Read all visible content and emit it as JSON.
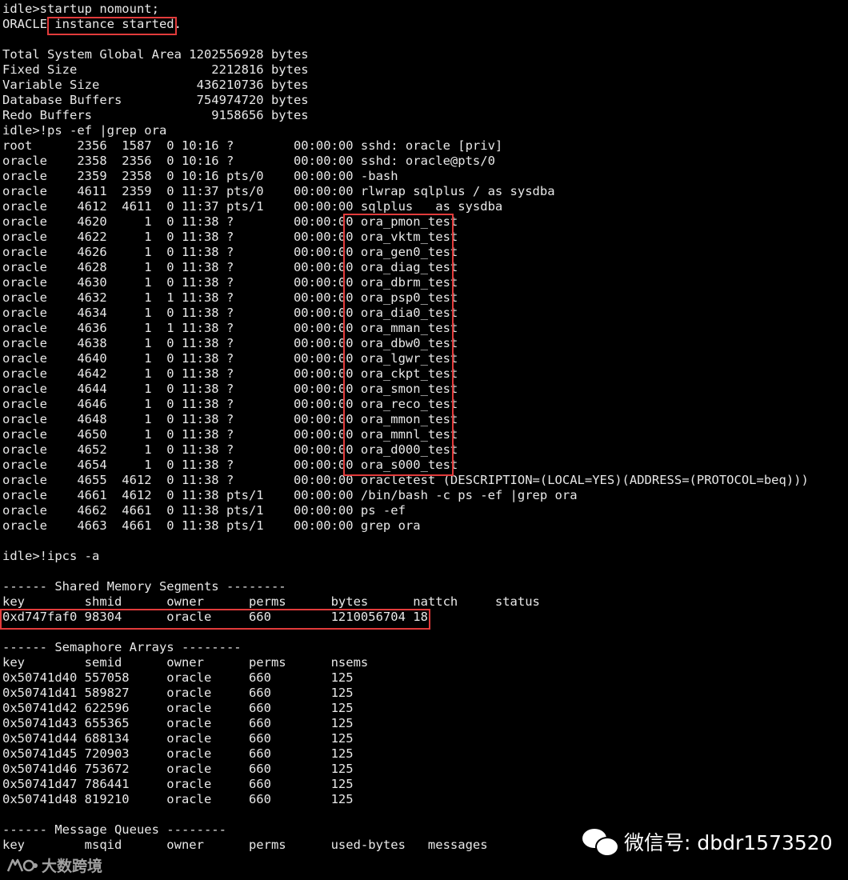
{
  "terminal": {
    "lines": [
      "idle>startup nomount;",
      "ORACLE instance started.",
      "",
      "Total System Global Area 1202556928 bytes",
      "Fixed Size                  2212816 bytes",
      "Variable Size             436210736 bytes",
      "Database Buffers          754974720 bytes",
      "Redo Buffers                9158656 bytes",
      "idle>!ps -ef |grep ora",
      "root      2356  1587  0 10:16 ?        00:00:00 sshd: oracle [priv]",
      "oracle    2358  2356  0 10:16 ?        00:00:00 sshd: oracle@pts/0",
      "oracle    2359  2358  0 10:16 pts/0    00:00:00 -bash",
      "oracle    4611  2359  0 11:37 pts/0    00:00:00 rlwrap sqlplus / as sysdba",
      "oracle    4612  4611  0 11:37 pts/1    00:00:00 sqlplus   as sysdba",
      "oracle    4620     1  0 11:38 ?        00:00:00 ora_pmon_test",
      "oracle    4622     1  0 11:38 ?        00:00:00 ora_vktm_test",
      "oracle    4626     1  0 11:38 ?        00:00:00 ora_gen0_test",
      "oracle    4628     1  0 11:38 ?        00:00:00 ora_diag_test",
      "oracle    4630     1  0 11:38 ?        00:00:00 ora_dbrm_test",
      "oracle    4632     1  1 11:38 ?        00:00:00 ora_psp0_test",
      "oracle    4634     1  0 11:38 ?        00:00:00 ora_dia0_test",
      "oracle    4636     1  1 11:38 ?        00:00:00 ora_mman_test",
      "oracle    4638     1  0 11:38 ?        00:00:00 ora_dbw0_test",
      "oracle    4640     1  0 11:38 ?        00:00:00 ora_lgwr_test",
      "oracle    4642     1  0 11:38 ?        00:00:00 ora_ckpt_test",
      "oracle    4644     1  0 11:38 ?        00:00:00 ora_smon_test",
      "oracle    4646     1  0 11:38 ?        00:00:00 ora_reco_test",
      "oracle    4648     1  0 11:38 ?        00:00:00 ora_mmon_test",
      "oracle    4650     1  0 11:38 ?        00:00:00 ora_mmnl_test",
      "oracle    4652     1  0 11:38 ?        00:00:00 ora_d000_test",
      "oracle    4654     1  0 11:38 ?        00:00:00 ora_s000_test",
      "oracle    4655  4612  0 11:38 ?        00:00:00 oracletest (DESCRIPTION=(LOCAL=YES)(ADDRESS=(PROTOCOL=beq)))",
      "oracle    4661  4612  0 11:38 pts/1    00:00:00 /bin/bash -c ps -ef |grep ora",
      "oracle    4662  4661  0 11:38 pts/1    00:00:00 ps -ef",
      "oracle    4663  4661  0 11:38 pts/1    00:00:00 grep ora",
      "",
      "idle>!ipcs -a",
      "",
      "------ Shared Memory Segments --------",
      "key        shmid      owner      perms      bytes      nattch     status",
      "0xd747faf0 98304      oracle     660        1210056704 18",
      "",
      "------ Semaphore Arrays --------",
      "key        semid      owner      perms      nsems",
      "0x50741d40 557058     oracle     660        125",
      "0x50741d41 589827     oracle     660        125",
      "0x50741d42 622596     oracle     660        125",
      "0x50741d43 655365     oracle     660        125",
      "0x50741d44 688134     oracle     660        125",
      "0x50741d45 720903     oracle     660        125",
      "0x50741d46 753672     oracle     660        125",
      "0x50741d47 786441     oracle     660        125",
      "0x50741d48 819210     oracle     660        125",
      "",
      "------ Message Queues --------",
      "key        msqid      owner      perms      used-bytes   messages"
    ]
  },
  "highlight_color": "#e23b3b",
  "watermark": {
    "wechat_text": "微信号: dbdr1573520",
    "wechat_icon": "wechat-icon",
    "brand_text": "大数跨境",
    "brand_icon": "brand-logo-icon"
  }
}
